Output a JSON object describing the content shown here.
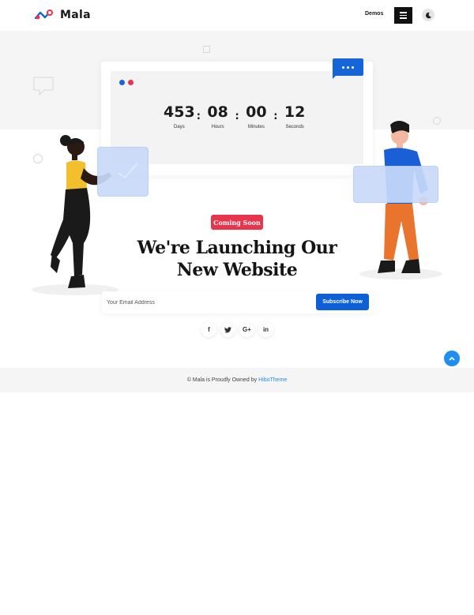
{
  "header": {
    "brand": "Mala",
    "nav_demos": "Demos",
    "menu_icon": "hamburger-icon",
    "mode_icon": "moon-icon"
  },
  "countdown": [
    {
      "value": "453",
      "label": "Days"
    },
    {
      "value": "08",
      "label": "Hours"
    },
    {
      "value": "00",
      "label": "Minutes"
    },
    {
      "value": "12",
      "label": "Seconds"
    }
  ],
  "countdown_separator": ":",
  "hero": {
    "badge": "Coming Soon",
    "headline_line1": "We're Launching Our",
    "headline_line2": "New Website"
  },
  "subscribe": {
    "placeholder": "Your Email Address",
    "button_label": "Subscribe Now"
  },
  "socials": [
    {
      "name": "facebook-icon",
      "glyph": "f"
    },
    {
      "name": "twitter-icon",
      "glyph": "🐦"
    },
    {
      "name": "google-plus-icon",
      "glyph": "G+"
    },
    {
      "name": "linkedin-icon",
      "glyph": "in"
    }
  ],
  "footer": {
    "text": "© Mala is Proudly Owned by",
    "link": "HiboTheme"
  },
  "colors": {
    "primary": "#0d5fd8",
    "badge": "#e8344c",
    "accent_light_blue": "#1e8ff0"
  }
}
